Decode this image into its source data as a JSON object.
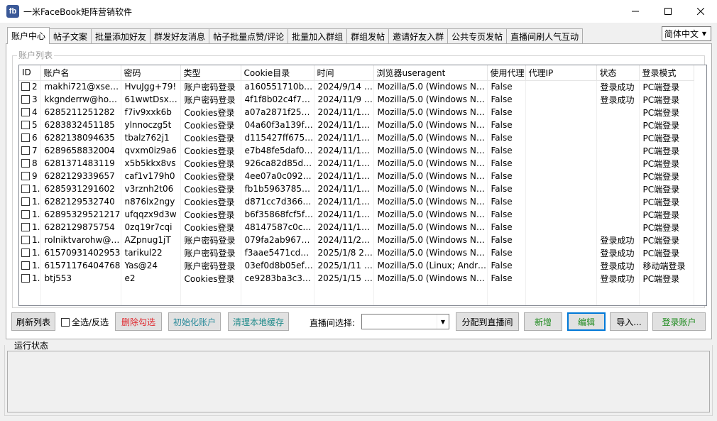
{
  "window": {
    "title": "一米FaceBook矩阵营销软件",
    "icon_text": "fb",
    "icon_color": "#3b5998"
  },
  "tabs": [
    {
      "label": "账户中心",
      "active": true
    },
    {
      "label": "帖子文案"
    },
    {
      "label": "批量添加好友"
    },
    {
      "label": "群发好友消息"
    },
    {
      "label": "帖子批量点赞/评论"
    },
    {
      "label": "批量加入群组"
    },
    {
      "label": "群组发帖"
    },
    {
      "label": "邀请好友入群"
    },
    {
      "label": "公共专页发帖"
    },
    {
      "label": "直播间刷人气互动"
    }
  ],
  "language": {
    "selected": "简体中文"
  },
  "account_list": {
    "caption": "账户列表",
    "columns": [
      "ID",
      "账户名",
      "密码",
      "类型",
      "Cookie目录",
      "时间",
      "浏览器useragent",
      "使用代理",
      "代理IP",
      "状态",
      "登录模式"
    ],
    "rows": [
      [
        "2",
        "makhi721@xsel…",
        "HvuJgg+79!",
        "账户密码登录",
        "a160551710b…",
        "2024/9/14 …",
        "Mozilla/5.0 (Windows N…",
        "False",
        "",
        "登录成功",
        "PC端登录"
      ],
      [
        "3",
        "kkgnderrw@ho…",
        "61wwtDsx…",
        "账户密码登录",
        "4f1f8b02c4f76…",
        "2024/11/9 …",
        "Mozilla/5.0 (Windows N…",
        "False",
        "",
        "登录成功",
        "PC端登录"
      ],
      [
        "4",
        "6285211251282",
        "f7iv9xxk6b",
        "Cookies登录",
        "a07a2871f255…",
        "2024/11/1…",
        "Mozilla/5.0 (Windows N…",
        "False",
        "",
        "",
        "PC端登录"
      ],
      [
        "5",
        "6283832451185",
        "ylnnoczg5t",
        "Cookies登录",
        "04a60f3a139f…",
        "2024/11/1…",
        "Mozilla/5.0 (Windows N…",
        "False",
        "",
        "",
        "PC端登录"
      ],
      [
        "6",
        "6282138094635",
        "tbalz762j1",
        "Cookies登录",
        "d115427ff675…",
        "2024/11/1…",
        "Mozilla/5.0 (Windows N…",
        "False",
        "",
        "",
        "PC端登录"
      ],
      [
        "7",
        "6289658832004",
        "qvxm0iz9a6",
        "Cookies登录",
        "e7b48fe5daf0…",
        "2024/11/1…",
        "Mozilla/5.0 (Windows N…",
        "False",
        "",
        "",
        "PC端登录"
      ],
      [
        "8",
        "6281371483119",
        "x5b5kkx8vs",
        "Cookies登录",
        "926ca82d85d…",
        "2024/11/1…",
        "Mozilla/5.0 (Windows N…",
        "False",
        "",
        "",
        "PC端登录"
      ],
      [
        "9",
        "6282129339657",
        "caf1v179h0",
        "Cookies登录",
        "4ee07a0c092…",
        "2024/11/1…",
        "Mozilla/5.0 (Windows N…",
        "False",
        "",
        "",
        "PC端登录"
      ],
      [
        "1.",
        "6285931291602",
        "v3rznh2t06",
        "Cookies登录",
        "fb1b5963785…",
        "2024/11/1…",
        "Mozilla/5.0 (Windows N…",
        "False",
        "",
        "",
        "PC端登录"
      ],
      [
        "1.",
        "6282129532740",
        "n876lx2ngy",
        "Cookies登录",
        "d871cc7d366…",
        "2024/11/1…",
        "Mozilla/5.0 (Windows N…",
        "False",
        "",
        "",
        "PC端登录"
      ],
      [
        "1.",
        "62895329521217",
        "ufqqzx9d3w",
        "Cookies登录",
        "b6f35868fcf5f…",
        "2024/11/1…",
        "Mozilla/5.0 (Windows N…",
        "False",
        "",
        "",
        "PC端登录"
      ],
      [
        "1.",
        "6282129875754",
        "0zq19r7cqi",
        "Cookies登录",
        "48147587c0c3…",
        "2024/11/1…",
        "Mozilla/5.0 (Windows N…",
        "False",
        "",
        "",
        "PC端登录"
      ],
      [
        "1.",
        "rolniktvarohw@…",
        "AZpnug1jT",
        "账户密码登录",
        "079fa2ab9677…",
        "2024/11/2…",
        "Mozilla/5.0 (Windows N…",
        "False",
        "",
        "登录成功",
        "PC端登录"
      ],
      [
        "1.",
        "61570931402953",
        "tarikul22",
        "账户密码登录",
        "f3aae5471cd7…",
        "2025/1/8 2…",
        "Mozilla/5.0 (Windows N…",
        "False",
        "",
        "登录成功",
        "PC端登录"
      ],
      [
        "1.",
        "61571176404768",
        "Yas@24",
        "账户密码登录",
        "03ef0d8b05ef…",
        "2025/1/11 …",
        "Mozilla/5.0 (Linux; Andr…",
        "False",
        "",
        "登录成功",
        "移动端登录"
      ],
      [
        "1.",
        "btj553",
        "e2",
        "Cookies登录",
        "ce9283ba3c3f…",
        "2025/1/15 …",
        "Mozilla/5.0 (Windows N…",
        "False",
        "",
        "登录成功",
        "PC端登录"
      ]
    ]
  },
  "toolbar": {
    "refresh": "刷新列表",
    "select_all": "全选/反选",
    "delete": "删除勾选",
    "init": "初始化账户",
    "clear_cache": "清理本地缓存",
    "live_label": "直播间选择:",
    "live_value": "",
    "assign": "分配到直播间",
    "add": "新增",
    "edit": "编辑",
    "import": "导入...",
    "login": "登录账户",
    "colors": {
      "delete": "#e0282e",
      "init": "#2a8a9a",
      "clear_cache": "#1f8a8a",
      "green": "#1e8a1e"
    }
  },
  "status": {
    "caption": "运行状态",
    "text": ""
  }
}
